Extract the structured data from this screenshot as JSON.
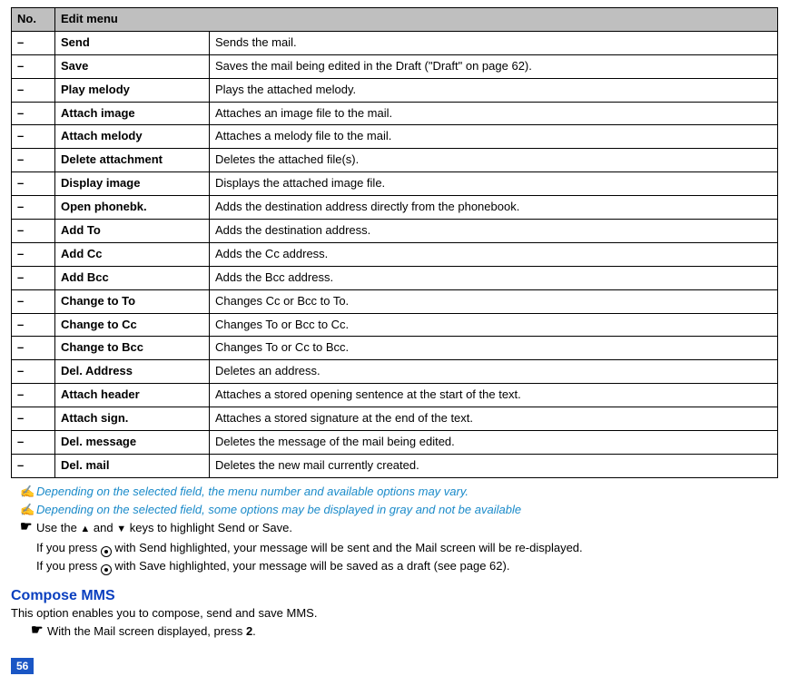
{
  "table": {
    "headers": {
      "no": "No.",
      "menu": "Edit menu",
      "desc": ""
    },
    "rows": [
      {
        "no": "–",
        "name": "Send",
        "desc": "Sends the mail."
      },
      {
        "no": "–",
        "name": "Save",
        "desc": "Saves the mail being edited in the Draft (\"Draft\" on page 62)."
      },
      {
        "no": "–",
        "name": "Play melody",
        "desc": "Plays the attached melody."
      },
      {
        "no": "–",
        "name": "Attach image",
        "desc": "Attaches an image file to the mail."
      },
      {
        "no": "–",
        "name": "Attach melody",
        "desc": "Attaches a melody file to the mail."
      },
      {
        "no": "–",
        "name": "Delete attachment",
        "desc": "Deletes the attached file(s)."
      },
      {
        "no": "–",
        "name": "Display image",
        "desc": "Displays the attached image file."
      },
      {
        "no": "–",
        "name": "Open phonebk.",
        "desc": "Adds the destination address directly from the phonebook."
      },
      {
        "no": "–",
        "name": "Add To",
        "desc": "Adds the destination address."
      },
      {
        "no": "–",
        "name": "Add Cc",
        "desc": "Adds the Cc address."
      },
      {
        "no": "–",
        "name": "Add Bcc",
        "desc": "Adds the Bcc address."
      },
      {
        "no": "–",
        "name": "Change to To",
        "desc": "Changes Cc or Bcc to To."
      },
      {
        "no": "–",
        "name": "Change to Cc",
        "desc": "Changes To or Bcc to Cc."
      },
      {
        "no": "–",
        "name": "Change to Bcc",
        "desc": "Changes To or Cc to Bcc."
      },
      {
        "no": "–",
        "name": "Del. Address",
        "desc": "Deletes an address."
      },
      {
        "no": "–",
        "name": "Attach header",
        "desc": "Attaches a stored opening sentence at the start of the text."
      },
      {
        "no": "–",
        "name": "Attach sign.",
        "desc": "Attaches a stored signature at the end of the text."
      },
      {
        "no": "–",
        "name": "Del. message",
        "desc": "Deletes the message of the mail being edited."
      },
      {
        "no": "–",
        "name": "Del. mail",
        "desc": "Deletes the new mail currently created."
      }
    ]
  },
  "notes": {
    "n1": "Depending on the selected field, the menu number and available options may vary.",
    "n2": "Depending on the selected field, some options may be displayed in gray and not be available",
    "n3_pre": "Use the ",
    "n3_mid": " and ",
    "n3_post": " keys to highlight Send or Save.",
    "n3_sub1_pre": "If you press ",
    "n3_sub1_post": " with Send highlighted, your message will be sent and the Mail screen will be re-displayed.",
    "n3_sub2_pre": "If you press ",
    "n3_sub2_post": " with Save highlighted, your message will be saved as a draft (see page 62)."
  },
  "section": {
    "heading": "Compose MMS",
    "body": "This option enables you to compose, send and save MMS.",
    "step_pre": "With the Mail screen displayed, press ",
    "step_key": "2",
    "step_post": "."
  },
  "pageNumber": "56"
}
